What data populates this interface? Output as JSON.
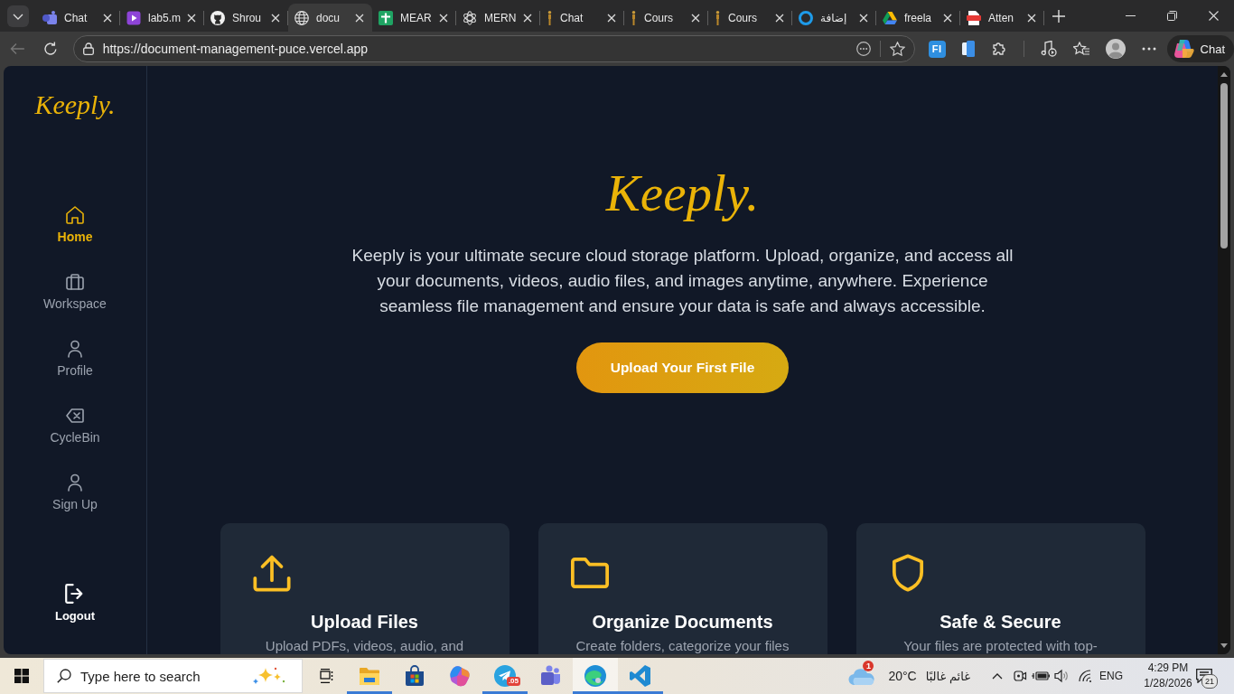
{
  "browser": {
    "tabs": [
      {
        "title": "Chat",
        "kind": "team",
        "selected": false
      },
      {
        "title": "lab5.m",
        "kind": "video",
        "selected": false
      },
      {
        "title": "Shrou",
        "kind": "cat",
        "selected": false
      },
      {
        "title": "docu",
        "kind": "globe",
        "selected": true
      },
      {
        "title": "MEAR",
        "kind": "sheet",
        "selected": false
      },
      {
        "title": "MERN",
        "kind": "knot",
        "selected": false
      },
      {
        "title": "Chat",
        "kind": "figure",
        "selected": false
      },
      {
        "title": "Cours",
        "kind": "figure",
        "selected": false
      },
      {
        "title": "Cours",
        "kind": "figure",
        "selected": false
      },
      {
        "title": "إضافة",
        "kind": "ring",
        "selected": false
      },
      {
        "title": "freela",
        "kind": "drive",
        "selected": false
      },
      {
        "title": "Atten",
        "kind": "pdf",
        "selected": false
      }
    ],
    "back": {
      "disabled": true
    },
    "url": "https://document-management-puce.vercel.app",
    "extension_label": "FI",
    "chat_button": "Chat"
  },
  "sidebar": {
    "logo": "Keeply.",
    "items": [
      {
        "label": "Home",
        "kind": "home",
        "selected": true
      },
      {
        "label": "Workspace",
        "kind": "briefcase",
        "selected": false
      },
      {
        "label": "Profile",
        "kind": "user",
        "selected": false
      },
      {
        "label": "CycleBin",
        "kind": "erase",
        "selected": false
      },
      {
        "label": "Sign Up",
        "kind": "user",
        "selected": false
      }
    ],
    "logout": "Logout"
  },
  "hero": {
    "logo": "Keeply.",
    "text": "Keeply is your ultimate secure cloud storage platform. Upload, organize, and access all your documents, videos, audio files, and images anytime, anywhere. Experience seamless file management and ensure your data is safe and always accessible.",
    "button": "Upload Your First File"
  },
  "features": [
    {
      "kind": "upload",
      "title": "Upload Files",
      "text": "Upload PDFs, videos, audio, and"
    },
    {
      "kind": "folder",
      "title": "Organize Documents",
      "text": "Create folders, categorize your files"
    },
    {
      "kind": "shield",
      "title": "Safe & Secure",
      "text": "Your files are protected with top-"
    }
  ],
  "taskbar": {
    "search_placeholder": "Type here to search",
    "apps": [
      {
        "kind": "folder",
        "running": true,
        "selected": false
      },
      {
        "kind": "store",
        "running": false,
        "selected": false
      },
      {
        "kind": "blob",
        "running": false,
        "selected": false
      },
      {
        "kind": "plane",
        "running": true,
        "selected": false,
        "badge": ".05"
      },
      {
        "kind": "team",
        "running": false,
        "selected": false
      },
      {
        "kind": "swirl",
        "running": true,
        "selected": true
      },
      {
        "kind": "ribbon",
        "running": true,
        "selected": false
      }
    ],
    "weather": {
      "badge": "1",
      "temperature": "20°C",
      "condition": "غائم غالبًا"
    },
    "language": "ENG",
    "time": "4:29 PM",
    "date": "1/28/2026",
    "notifications": "21"
  }
}
